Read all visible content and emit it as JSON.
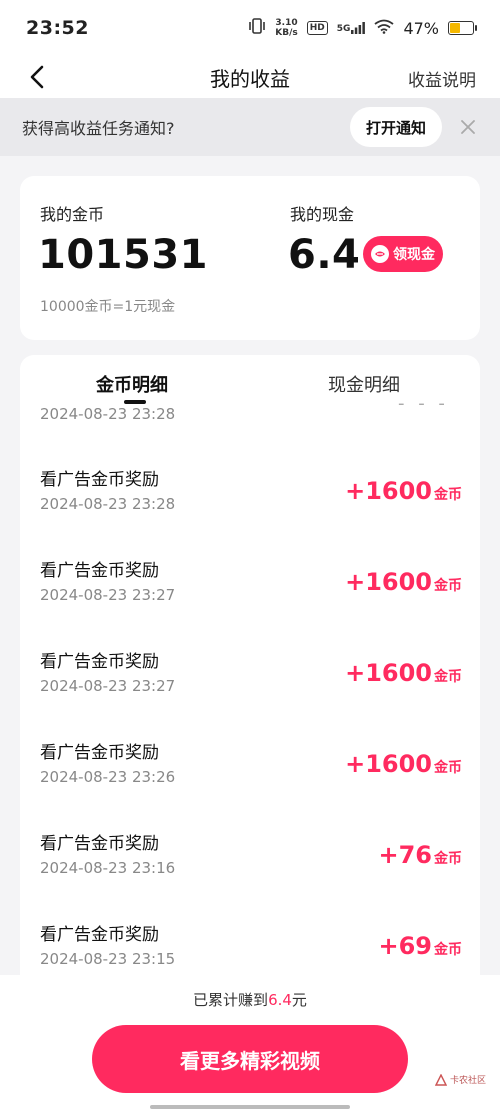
{
  "status_bar": {
    "time": "23:52",
    "speed_value": "3.10",
    "speed_unit": "KB/s",
    "hd": "HD",
    "network": "5G",
    "battery": "47%",
    "battery_level": 0.47
  },
  "header": {
    "title": "我的收益",
    "right_link": "收益说明"
  },
  "notice": {
    "text": "获得高收益任务通知?",
    "button": "打开通知"
  },
  "balance": {
    "coin_label": "我的金币",
    "coin_value": "101531",
    "cash_label": "我的现金",
    "cash_value": "6.4",
    "claim_button": "领现金",
    "rate_text": "10000金币=1元现金"
  },
  "details": {
    "tabs": [
      "金币明细",
      "现金明细"
    ],
    "partial_time": "2024-08-23 23:28",
    "partial_dots": "- - -",
    "rows": [
      {
        "title": "看广告金币奖励",
        "time": "2024-08-23 23:28",
        "amount": "+1600",
        "unit": "金币"
      },
      {
        "title": "看广告金币奖励",
        "time": "2024-08-23 23:27",
        "amount": "+1600",
        "unit": "金币"
      },
      {
        "title": "看广告金币奖励",
        "time": "2024-08-23 23:27",
        "amount": "+1600",
        "unit": "金币"
      },
      {
        "title": "看广告金币奖励",
        "time": "2024-08-23 23:26",
        "amount": "+1600",
        "unit": "金币"
      },
      {
        "title": "看广告金币奖励",
        "time": "2024-08-23 23:16",
        "amount": "+76",
        "unit": "金币"
      },
      {
        "title": "看广告金币奖励",
        "time": "2024-08-23 23:15",
        "amount": "+69",
        "unit": "金币"
      }
    ]
  },
  "bottom": {
    "total_prefix": "已累计赚到",
    "total_amount": "6.4",
    "total_suffix": "元",
    "cta": "看更多精彩视频",
    "watermark": "卡农社区"
  },
  "colors": {
    "accent": "#ff2a5f",
    "page_bg": "#f4f4f6",
    "notice_bg": "#e9e9ec",
    "battery": "#f5b800"
  }
}
